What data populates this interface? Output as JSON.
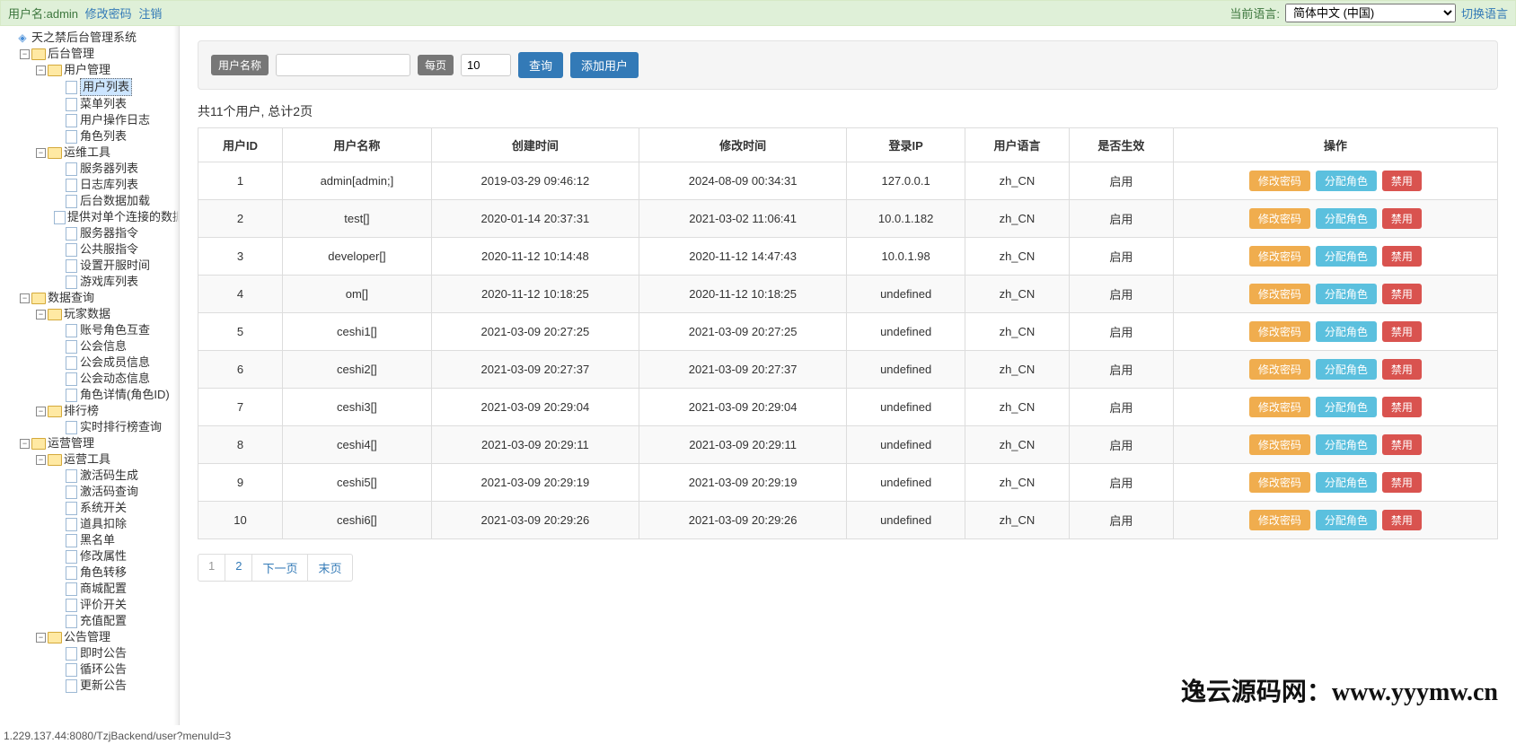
{
  "topbar": {
    "username_label": "用户名:",
    "username": "admin",
    "change_pwd": "修改密码",
    "logout": "注销",
    "lang_label": "当前语言:",
    "lang_selected": "简体中文 (中国)",
    "switch_lang": "切换语言"
  },
  "tree": {
    "root": "天之禁后台管理系统",
    "backend_mgmt": "后台管理",
    "user_mgmt": "用户管理",
    "user_list": "用户列表",
    "menu_list": "菜单列表",
    "user_op_log": "用户操作日志",
    "role_list": "角色列表",
    "ops_tools": "运维工具",
    "server_list": "服务器列表",
    "log_repo_list": "日志库列表",
    "backend_data_load": "后台数据加载",
    "single_conn_data": "提供对单个连接的数据",
    "server_cmd": "服务器指令",
    "public_cmd": "公共服指令",
    "set_open_time": "设置开服时间",
    "game_repo_list": "游戏库列表",
    "data_query": "数据查询",
    "player_data": "玩家数据",
    "acct_role_xcheck": "账号角色互查",
    "guild_info": "公会信息",
    "guild_member_info": "公会成员信息",
    "guild_dynamic_info": "公会动态信息",
    "role_detail": "角色详情(角色ID)",
    "leaderboard": "排行榜",
    "realtime_leaderboard": "实时排行榜查询",
    "operation_mgmt": "运营管理",
    "operation_tools": "运营工具",
    "activation_gen": "激活码生成",
    "activation_query": "激活码查询",
    "system_switch": "系统开关",
    "item_deduct": "道具扣除",
    "blacklist": "黑名单",
    "modify_attr": "修改属性",
    "role_transfer": "角色转移",
    "mall_config": "商城配置",
    "review_switch": "评价开关",
    "recharge_config": "充值配置",
    "notice_mgmt": "公告管理",
    "instant_notice": "即时公告",
    "loop_notice": "循环公告",
    "update_notice": "更新公告"
  },
  "search": {
    "username_label": "用户名称",
    "username_value": "",
    "perpage_label": "每页",
    "perpage_value": "10",
    "query": "查询",
    "add_user": "添加用户"
  },
  "summary": "共11个用户, 总计2页",
  "table": {
    "headers": [
      "用户ID",
      "用户名称",
      "创建时间",
      "修改时间",
      "登录IP",
      "用户语言",
      "是否生效",
      "操作"
    ],
    "ops": {
      "change_pwd": "修改密码",
      "assign_role": "分配角色",
      "disable": "禁用"
    },
    "rows": [
      {
        "id": "1",
        "name": "admin[admin;]",
        "create": "2019-03-29 09:46:12",
        "modify": "2024-08-09 00:34:31",
        "ip": "127.0.0.1",
        "lang": "zh_CN",
        "active": "启用"
      },
      {
        "id": "2",
        "name": "test[]",
        "create": "2020-01-14 20:37:31",
        "modify": "2021-03-02 11:06:41",
        "ip": "10.0.1.182",
        "lang": "zh_CN",
        "active": "启用"
      },
      {
        "id": "3",
        "name": "developer[]",
        "create": "2020-11-12 10:14:48",
        "modify": "2020-11-12 14:47:43",
        "ip": "10.0.1.98",
        "lang": "zh_CN",
        "active": "启用"
      },
      {
        "id": "4",
        "name": "om[]",
        "create": "2020-11-12 10:18:25",
        "modify": "2020-11-12 10:18:25",
        "ip": "undefined",
        "lang": "zh_CN",
        "active": "启用"
      },
      {
        "id": "5",
        "name": "ceshi1[]",
        "create": "2021-03-09 20:27:25",
        "modify": "2021-03-09 20:27:25",
        "ip": "undefined",
        "lang": "zh_CN",
        "active": "启用"
      },
      {
        "id": "6",
        "name": "ceshi2[]",
        "create": "2021-03-09 20:27:37",
        "modify": "2021-03-09 20:27:37",
        "ip": "undefined",
        "lang": "zh_CN",
        "active": "启用"
      },
      {
        "id": "7",
        "name": "ceshi3[]",
        "create": "2021-03-09 20:29:04",
        "modify": "2021-03-09 20:29:04",
        "ip": "undefined",
        "lang": "zh_CN",
        "active": "启用"
      },
      {
        "id": "8",
        "name": "ceshi4[]",
        "create": "2021-03-09 20:29:11",
        "modify": "2021-03-09 20:29:11",
        "ip": "undefined",
        "lang": "zh_CN",
        "active": "启用"
      },
      {
        "id": "9",
        "name": "ceshi5[]",
        "create": "2021-03-09 20:29:19",
        "modify": "2021-03-09 20:29:19",
        "ip": "undefined",
        "lang": "zh_CN",
        "active": "启用"
      },
      {
        "id": "10",
        "name": "ceshi6[]",
        "create": "2021-03-09 20:29:26",
        "modify": "2021-03-09 20:29:26",
        "ip": "undefined",
        "lang": "zh_CN",
        "active": "启用"
      }
    ]
  },
  "pagination": {
    "p1": "1",
    "p2": "2",
    "next": "下一页",
    "last": "末页"
  },
  "watermark": "逸云源码网：www.yyymw.cn",
  "statusbar": "1.229.137.44:8080/TzjBackend/user?menuId=3"
}
